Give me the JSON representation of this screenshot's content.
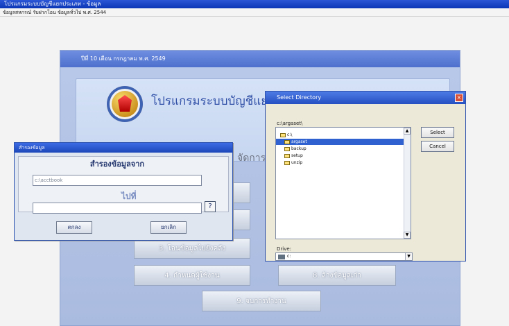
{
  "app": {
    "title": "โปรแกรมระบบบัญชีแยกประเภท - ข้อมูล",
    "status": "ข้อมูลสหกรณ์ รับฝากโอน ข้อมูลทั่วไป พ.ศ. 2544"
  },
  "main": {
    "header": "ปีที่ 10 เดือน กรกฎาคม พ.ศ. 2549",
    "program_title": "โปรแกรมระบบบัญชีแยกประเภท",
    "section_heading": "จัดการ",
    "buttons": {
      "btn3": "3. โอนข้อมูลไปยังคลัง",
      "btn4": "4. กำหนดผู้ใช้งาน",
      "btn8": "8. ล้างข้อมูลเก่า",
      "btn9": "9. จบการทำงาน"
    }
  },
  "copy_dialog": {
    "title": "สำรองข้อมูล",
    "heading": "สำรองข้อมูลจาก",
    "source_value": "c:\\acctbook",
    "target_label": "ไปที่",
    "target_value": "",
    "browse_label": "?",
    "ok_label": "ตกลง",
    "cancel_label": "ยกเลิก"
  },
  "directory_dialog": {
    "title": "Select Directory",
    "path": "c:\\argaset\\",
    "items": [
      {
        "name": "c:\\",
        "selected": false
      },
      {
        "name": "argaset",
        "selected": true
      },
      {
        "name": "backup",
        "selected": false
      },
      {
        "name": "setup",
        "selected": false
      },
      {
        "name": "unzip",
        "selected": false
      }
    ],
    "select_label": "Select",
    "cancel_label": "Cancel",
    "drives_label": "Drive:",
    "drive_value": "c:",
    "close_label": "×",
    "scroll_up": "▲",
    "scroll_down": "▼"
  }
}
